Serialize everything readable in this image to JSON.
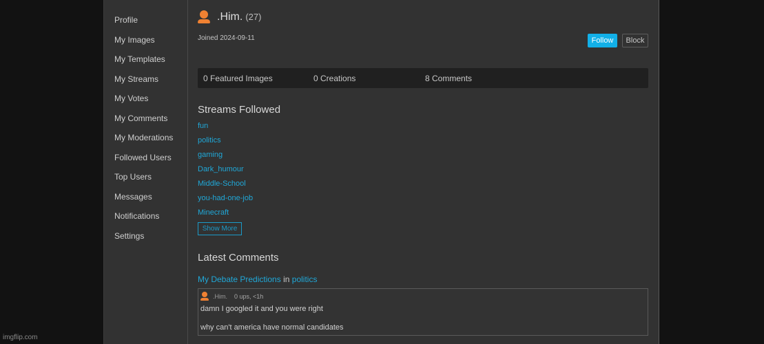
{
  "sidebar": {
    "items": [
      {
        "label": "Profile"
      },
      {
        "label": "My Images"
      },
      {
        "label": "My Templates"
      },
      {
        "label": "My Streams"
      },
      {
        "label": "My Votes"
      },
      {
        "label": "My Comments"
      },
      {
        "label": "My Moderations"
      },
      {
        "label": "Followed Users"
      },
      {
        "label": "Top Users"
      },
      {
        "label": "Messages"
      },
      {
        "label": "Notifications"
      },
      {
        "label": "Settings"
      }
    ]
  },
  "profile": {
    "username": ".Him.",
    "points": "(27)",
    "joined": "Joined 2024-09-11",
    "icon": "user-avatar-icon",
    "avatar_color": "#f08132",
    "follow_label": "Follow",
    "block_label": "Block",
    "accent_color": "#12b0e8"
  },
  "stats": {
    "featured": "0 Featured Images",
    "creations": "0 Creations",
    "comments": "8 Comments"
  },
  "streams": {
    "title": "Streams Followed",
    "items": [
      "fun",
      "politics",
      "gaming",
      "Dark_humour",
      "Middle-School",
      "you-had-one-job",
      "Minecraft"
    ],
    "show_more_label": "Show More"
  },
  "latest_comments": {
    "title": "Latest Comments",
    "items": [
      {
        "post_title": "My Debate Predictions",
        "in_label": "in",
        "stream": "politics",
        "author": ".Him.",
        "meta": "0 ups, <1h",
        "lines": [
          "damn I googled it and you were right",
          "why can't america have normal candidates"
        ]
      }
    ]
  },
  "watermark": "imgflip.com"
}
